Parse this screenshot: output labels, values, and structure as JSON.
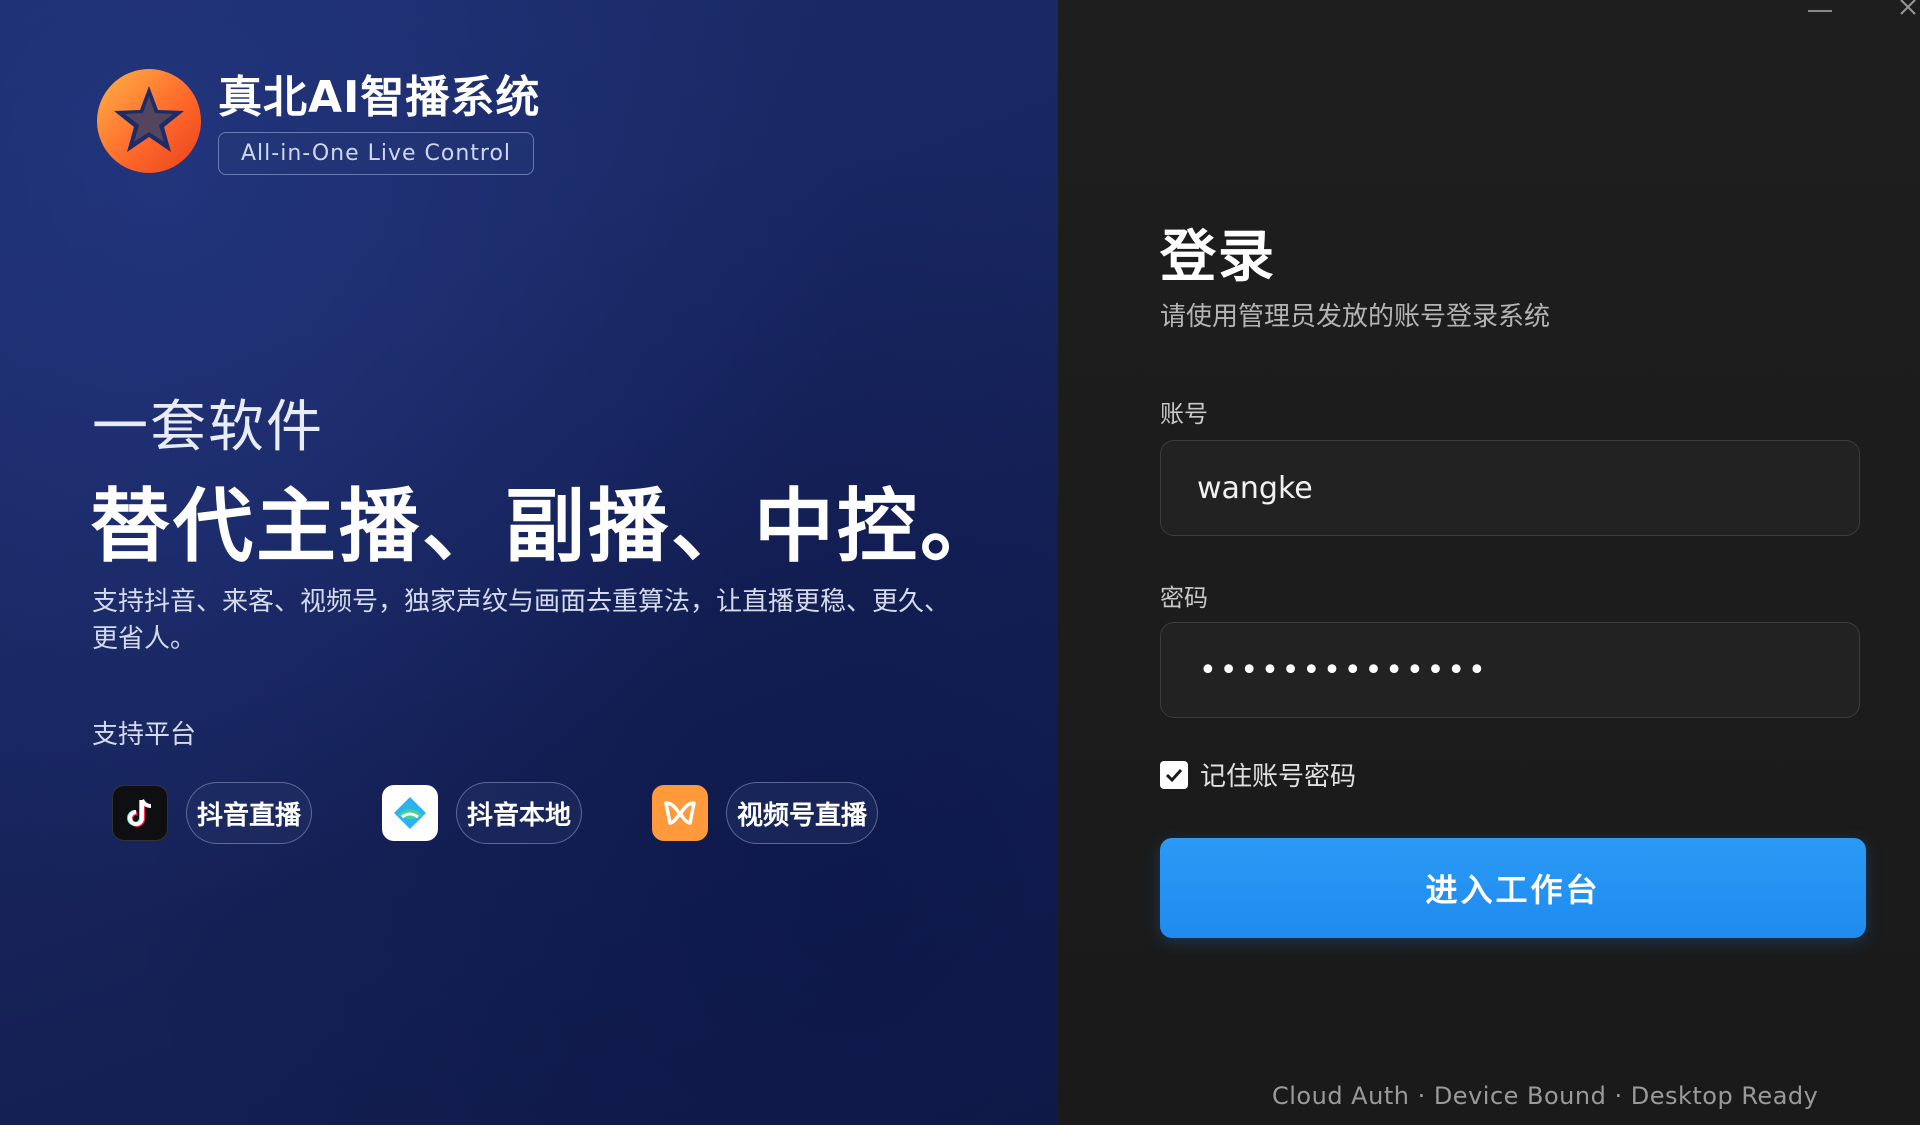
{
  "brand": {
    "title": "真北AI智播系统",
    "tagline": "All-in-One Live Control"
  },
  "hero": {
    "subtitle": "一套软件",
    "headline": "替代主播、副播、中控。",
    "description": "支持抖音、来客、视频号，独家声纹与画面去重算法，让直播更稳、更久、更省人。"
  },
  "platforms": {
    "title": "支持平台",
    "items": [
      {
        "label": "抖音直播",
        "icon": "douyin-icon"
      },
      {
        "label": "抖音本地",
        "icon": "douyin-laike-icon"
      },
      {
        "label": "视频号直播",
        "icon": "wechat-channels-icon"
      }
    ]
  },
  "login": {
    "title": "登录",
    "subtitle": "请使用管理员发放的账号登录系统",
    "account_label": "账号",
    "account_value": "wangke",
    "password_label": "密码",
    "password_mask": "••••••••••••••",
    "remember_label": "记住账号密码",
    "remember_checked": true,
    "submit_label": "进入工作台"
  },
  "footer": {
    "text": "Cloud Auth · Device Bound · Desktop Ready"
  },
  "colors": {
    "accent": "#1f8bef",
    "left_bg": "#182660",
    "right_bg": "#1c1c1c"
  }
}
